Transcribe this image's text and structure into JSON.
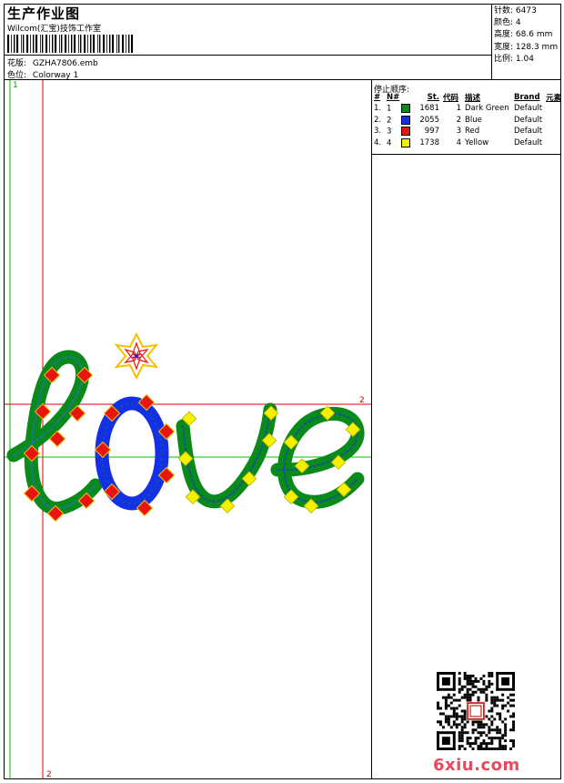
{
  "header": {
    "title": "生产作业图",
    "studio": "Wilcom(汇宝)技饰工作室",
    "design_label": "花版:",
    "design_file": "GZHA7806.emb",
    "colorway_label": "色位:",
    "colorway": "Colorway 1"
  },
  "stats": [
    {
      "label": "针数:",
      "value": "6473"
    },
    {
      "label": "颜色:",
      "value": "4"
    },
    {
      "label": "高度:",
      "value": "68.6 mm"
    },
    {
      "label": "宽度:",
      "value": "128.3 mm"
    },
    {
      "label": "比例:",
      "value": "1.04"
    }
  ],
  "stop_sequence": {
    "title": "停止顺序:",
    "headers": [
      "#",
      "N#",
      "St.",
      "代码",
      "描述",
      "Brand",
      "元素"
    ],
    "rows": [
      {
        "idx": "1.",
        "n": "1",
        "color": "#0a8a1a",
        "stitches": "1681",
        "code": "1",
        "desc": "Dark Green",
        "brand": "Default"
      },
      {
        "idx": "2.",
        "n": "2",
        "color": "#1430e6",
        "stitches": "2055",
        "code": "2",
        "desc": "Blue",
        "brand": "Default"
      },
      {
        "idx": "3.",
        "n": "3",
        "color": "#e8140e",
        "stitches": "997",
        "code": "3",
        "desc": "Red",
        "brand": "Default"
      },
      {
        "idx": "4.",
        "n": "4",
        "color": "#f5f000",
        "stitches": "1738",
        "code": "4",
        "desc": "Yellow",
        "brand": "Default"
      }
    ]
  },
  "canvas": {
    "guide_label_a": "1",
    "guide_label_b": "2",
    "guide_label_c": "2"
  },
  "watermark": "6xiu.com"
}
